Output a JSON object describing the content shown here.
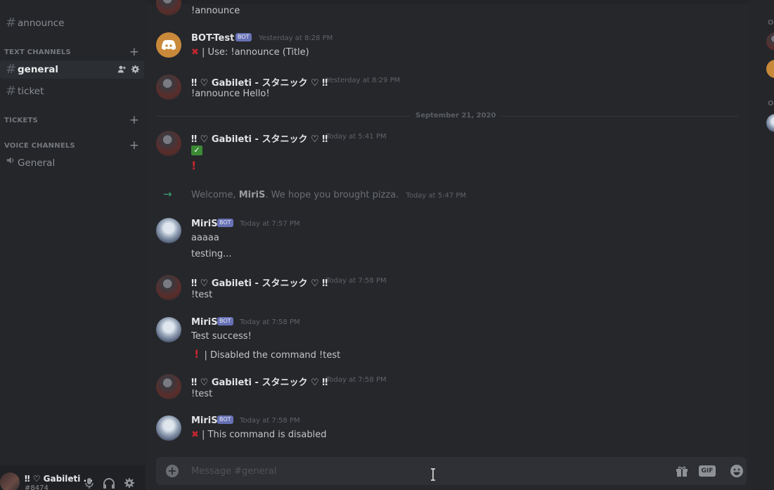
{
  "sidebar": {
    "channels_top": [
      {
        "label": "announce"
      }
    ],
    "text_category": "TEXT CHANNELS",
    "text_channels": [
      {
        "label": "general",
        "active": true
      },
      {
        "label": "ticket"
      }
    ],
    "tickets_category": "TICKETS",
    "voice_category": "VOICE CHANNELS",
    "voice_channels": [
      {
        "label": "General"
      }
    ],
    "user": {
      "name": "‼ ♡ Gabileti ...",
      "tag": "#8474"
    }
  },
  "chat": {
    "top_fragment": "!announce",
    "messages": [
      {
        "author": "BOT-Test",
        "bot": "BOT",
        "time": "Yesterday at 8:28 PM",
        "lines": [
          "| Use: !announce (Title)"
        ]
      },
      {
        "author": "‼ ♡ Gabileti - スタニック ♡ ‼",
        "time": "Yesterday at 8:29 PM",
        "lines": [
          "!announce Hello!"
        ]
      },
      {
        "author": "‼ ♡ Gabileti - スタニック ♡ ‼",
        "time": "Today at 5:41 PM",
        "lines": [
          "✓",
          "!"
        ]
      },
      {
        "author": "MiriS",
        "bot": "BOT",
        "time": "Today at 7:57 PM",
        "lines": [
          "aaaaa",
          "testing..."
        ]
      },
      {
        "author": "‼ ♡ Gabileti - スタニック ♡ ‼",
        "time": "Today at 7:58 PM",
        "lines": [
          "!test"
        ]
      },
      {
        "author": "MiriS",
        "bot": "BOT",
        "time": "Today at 7:58 PM",
        "lines": [
          "Test success!",
          "| Disabled the command !test"
        ]
      },
      {
        "author": "‼ ♡ Gabileti - スタニック ♡ ‼",
        "time": "Today at 7:58 PM",
        "lines": [
          "!test"
        ]
      },
      {
        "author": "MiriS",
        "bot": "BOT",
        "time": "Today at 7:58 PM",
        "lines": [
          "| This command is disabled"
        ]
      }
    ],
    "divider_label": "September 21, 2020",
    "join": {
      "prefix": "Welcome, ",
      "name": "MiriS",
      "suffix": ". We hope you brought pizza.",
      "time": "Today at 5:47 PM"
    },
    "composer": {
      "placeholder": "Message #general",
      "gif_label": "GIF"
    }
  },
  "members": {
    "headers": [
      "O",
      "O"
    ]
  },
  "colors": {
    "accent_bot": "#6771b5",
    "online": "#3ca374",
    "danger": "#c2272e"
  }
}
